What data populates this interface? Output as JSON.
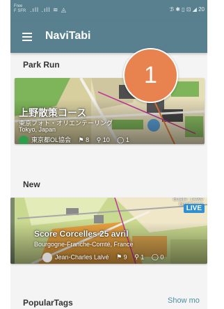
{
  "status_bar": {
    "carrier_line1": "Free",
    "carrier_line2": "F SFR",
    "signal_icons": ".ıll .ıll ≋ ◬",
    "right_icons": "ℬ ✱ ▯ ⊡ ◢ 20"
  },
  "app_bar": {
    "title": "NaviTabi",
    "menu_icon": "menu-icon"
  },
  "badge": {
    "number": "1",
    "color": "#e8834f"
  },
  "sections": {
    "park_run": {
      "title": "Park Run",
      "card": {
        "title": "上野散策コース",
        "subtitle": "東京フォト・オリエンテーリング",
        "location": "Tokyo, Japan",
        "author": "東京都OL協会",
        "stat1": "8",
        "stat2": "10",
        "stat3": "1"
      }
    },
    "new": {
      "title": "New",
      "card": {
        "title": "Score Corcelles 25 avril",
        "subtitle": "Bourgogne-Franche-Comté, France",
        "author": "Jean-Charles Lalvé",
        "stat1": "9",
        "stat2": "1",
        "stat3": "0",
        "live_label": "LIVE",
        "scale_line1": "Echelle : 1/4000",
        "scale_line2": "Equidistance"
      }
    },
    "popular_tags": {
      "title": "PopularTags",
      "show_more": "Show mo"
    }
  },
  "colors": {
    "app_bar": "#58808f",
    "accent": "#4a8fa3",
    "live": "#2f8fd1"
  }
}
